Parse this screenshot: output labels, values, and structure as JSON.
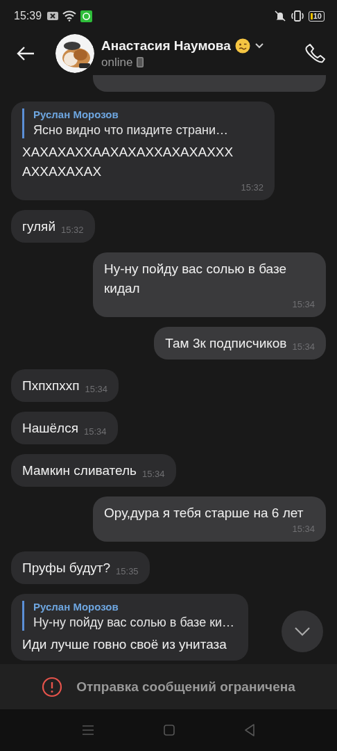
{
  "status_bar": {
    "time": "15:39",
    "battery": "10"
  },
  "header": {
    "name": "Анастасия Наумова",
    "status": "online"
  },
  "messages": [
    {
      "outgoing": true,
      "kind": "cut"
    },
    {
      "outgoing": false,
      "kind": "reply",
      "reply_name": "Руслан Морозов",
      "reply_text": "Ясно видно что пиздите страни…",
      "text": "ХАХАХАХХААХАХАХХАХАХАХХХ АХХАХАХАХ",
      "time": "15:32"
    },
    {
      "outgoing": false,
      "kind": "text",
      "text": "гуляй",
      "time": "15:32"
    },
    {
      "outgoing": true,
      "kind": "text",
      "text": "Ну-ну пойду вас солью в базе кидал",
      "time": "15:34"
    },
    {
      "outgoing": true,
      "kind": "text",
      "text": "Там 3к подписчиков",
      "time": "15:34"
    },
    {
      "outgoing": false,
      "kind": "text",
      "text": "Пхпхпххп",
      "time": "15:34"
    },
    {
      "outgoing": false,
      "kind": "text",
      "text": "Нашёлся",
      "time": "15:34"
    },
    {
      "outgoing": false,
      "kind": "text",
      "text": "Мамкин сливатель",
      "time": "15:34"
    },
    {
      "outgoing": true,
      "kind": "text",
      "text": "Ору,дура я тебя старше на 6 лет",
      "time": "15:34"
    },
    {
      "outgoing": false,
      "kind": "text",
      "text": "Пруфы будут?",
      "time": "15:35"
    },
    {
      "outgoing": false,
      "kind": "reply",
      "reply_name": "Руслан Морозов",
      "reply_text": "Ну-ну пойду вас солью в базе ки…",
      "text": "Иди лучше говно своё из унитаза"
    }
  ],
  "notice": "Отправка сообщений ограничена"
}
